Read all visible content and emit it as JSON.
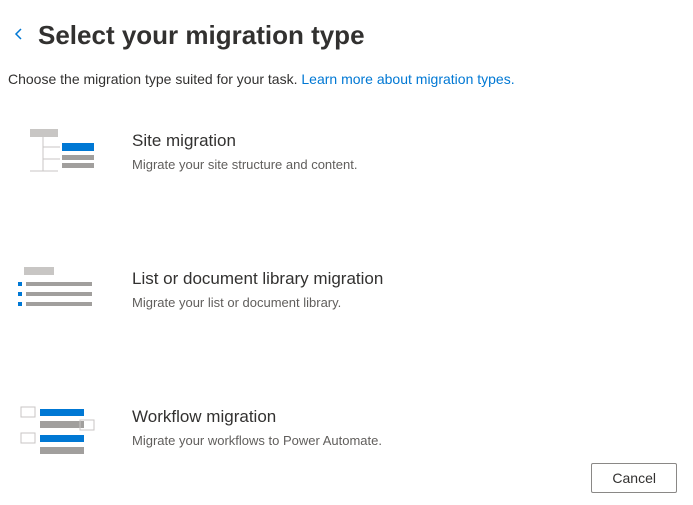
{
  "header": {
    "title": "Select your migration type"
  },
  "subtitle": {
    "intro": "Choose the migration type suited for your task. ",
    "link": "Learn more about migration types."
  },
  "options": [
    {
      "title": "Site migration",
      "desc": "Migrate your site structure and content."
    },
    {
      "title": "List or document library migration",
      "desc": "Migrate your list or document library."
    },
    {
      "title": "Workflow migration",
      "desc": "Migrate your workflows to Power Automate."
    }
  ],
  "footer": {
    "cancel": "Cancel"
  },
  "colors": {
    "accent": "#0078d4",
    "grayLight": "#c8c6c4",
    "grayMed": "#a19f9d"
  }
}
